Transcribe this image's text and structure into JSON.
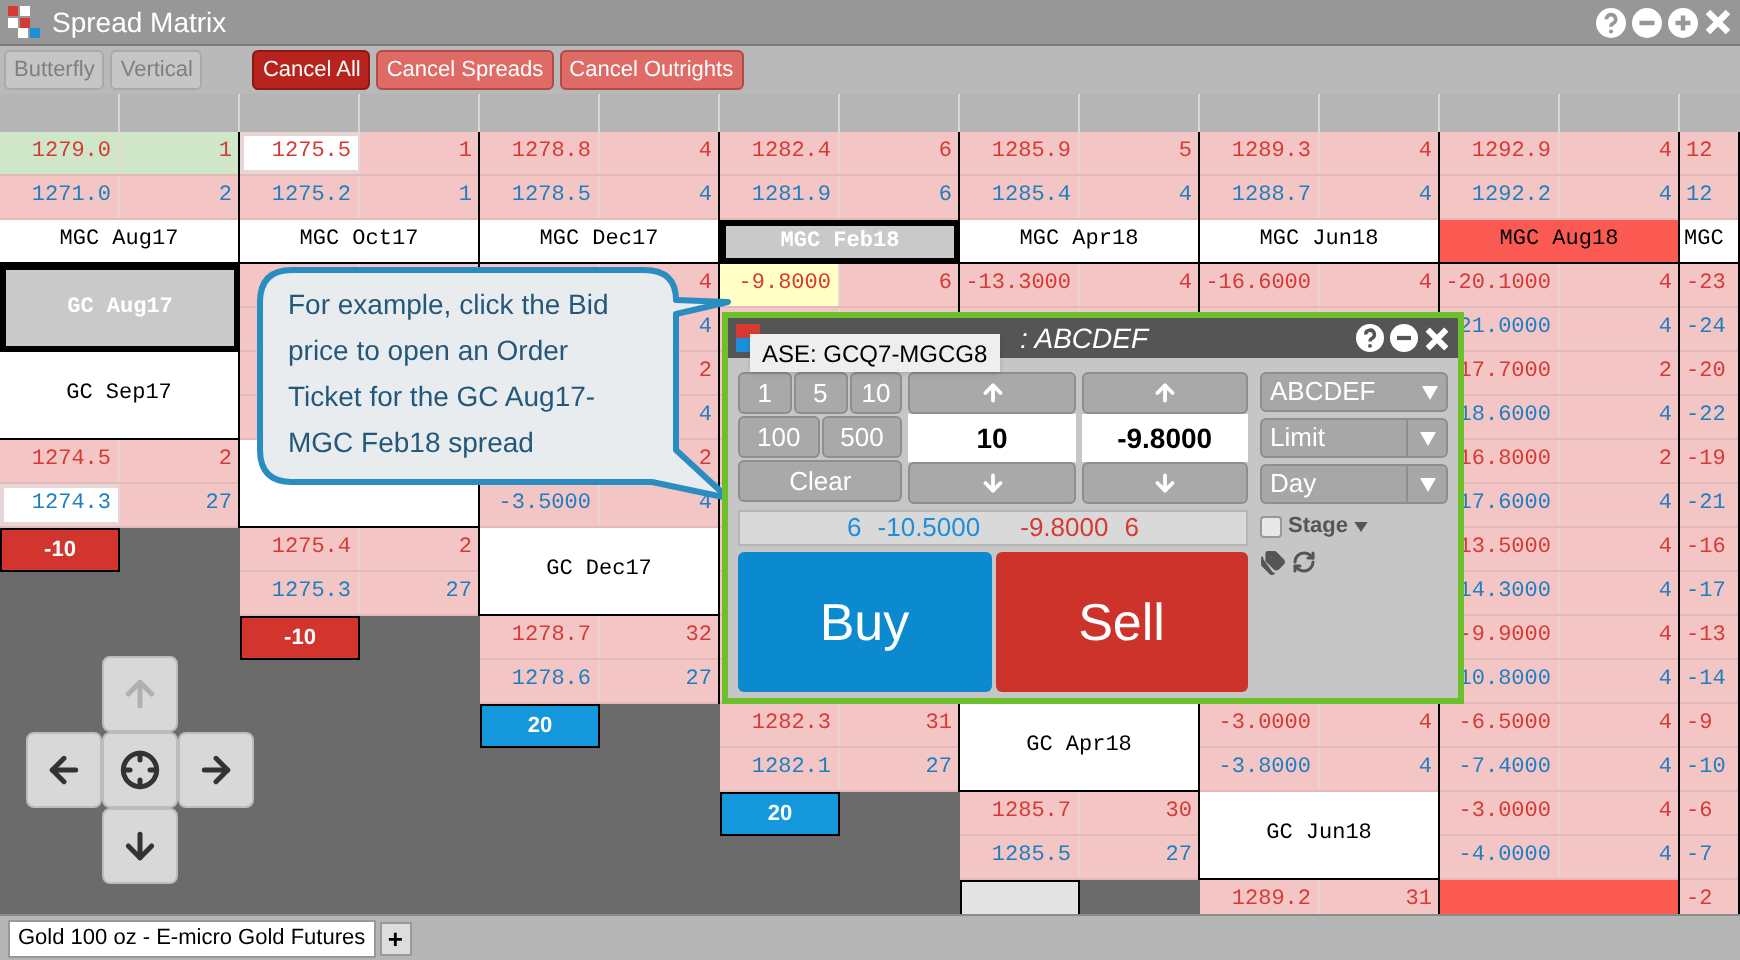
{
  "window": {
    "title": "Spread Matrix"
  },
  "toolbar": [
    {
      "label": "Butterfly",
      "kind": "toggle",
      "disabled": true
    },
    {
      "label": "Vertical",
      "kind": "toggle",
      "disabled": true
    },
    {
      "label": "Cancel All",
      "kind": "primary",
      "disabled": false
    },
    {
      "label": "Cancel Spreads",
      "kind": "secondary",
      "disabled": false
    },
    {
      "label": "Cancel Outrights",
      "kind": "secondary",
      "disabled": false
    }
  ],
  "matrix": {
    "rows": [
      {
        "kind": "quotes",
        "cells": [
          {
            "kind": "quote",
            "ask": {
              "price": "1279.0",
              "qty": "1",
              "shaded": true
            },
            "bid": {
              "price": "1271.0",
              "qty": "2"
            }
          },
          {
            "kind": "quote",
            "ask": {
              "price": "1275.5",
              "qty": "1",
              "outlined": true
            },
            "bid": {
              "price": "1275.2",
              "qty": "1"
            }
          },
          {
            "kind": "quote",
            "ask": {
              "price": "1278.8",
              "qty": "4"
            },
            "bid": {
              "price": "1278.5",
              "qty": "4"
            }
          },
          {
            "kind": "quote",
            "ask": {
              "price": "1282.4",
              "qty": "6"
            },
            "bid": {
              "price": "1281.9",
              "qty": "6"
            }
          },
          {
            "kind": "quote",
            "ask": {
              "price": "1285.9",
              "qty": "5"
            },
            "bid": {
              "price": "1285.4",
              "qty": "4"
            }
          },
          {
            "kind": "quote",
            "ask": {
              "price": "1289.3",
              "qty": "4"
            },
            "bid": {
              "price": "1288.7",
              "qty": "4"
            }
          },
          {
            "kind": "quote",
            "ask": {
              "price": "1292.9",
              "qty": "4"
            },
            "bid": {
              "price": "1292.2",
              "qty": "4"
            }
          },
          {
            "kind": "quote",
            "ask": {
              "price": "12"
            },
            "bid": {
              "price": "12"
            }
          }
        ]
      },
      {
        "kind": "labels",
        "cells": [
          {
            "kind": "label",
            "text": "MGC Aug17",
            "selected": false,
            "alert": false
          },
          {
            "kind": "label",
            "text": "MGC Oct17",
            "selected": false,
            "alert": false
          },
          {
            "kind": "label",
            "text": "MGC Dec17",
            "selected": false,
            "alert": false
          },
          {
            "kind": "label",
            "text": "MGC Feb18",
            "selected": true,
            "alert": false
          },
          {
            "kind": "label",
            "text": "MGC Apr18",
            "selected": false,
            "alert": false
          },
          {
            "kind": "label",
            "text": "MGC Jun18",
            "selected": false,
            "alert": false
          },
          {
            "kind": "label",
            "text": "MGC Aug18",
            "selected": false,
            "alert": true
          },
          {
            "kind": "label",
            "text": "MGC",
            "selected": false,
            "alert": false
          }
        ]
      },
      {
        "kind": "spreads",
        "cells": [
          {
            "kind": "label",
            "text": "GC Aug17",
            "selected": true,
            "alert": false
          },
          {
            "kind": "quote"
          },
          {
            "kind": "quote",
            "ask": {
              "qty": "4"
            },
            "bid": {
              "qty": "4"
            }
          },
          {
            "kind": "quote",
            "ask": {
              "price": "-9.8000",
              "qty": "6",
              "highlighted": true
            }
          },
          {
            "kind": "quote",
            "ask": {
              "price": "-13.3000",
              "qty": "4"
            }
          },
          {
            "kind": "quote",
            "ask": {
              "price": "-16.6000",
              "qty": "4"
            }
          },
          {
            "kind": "quote",
            "ask": {
              "price": "-20.1000",
              "qty": "4"
            },
            "bid": {
              "price": "21.0000",
              "qty": "4"
            }
          },
          {
            "kind": "quote",
            "ask": {
              "price": "-23"
            },
            "bid": {
              "price": "-24"
            }
          }
        ]
      },
      {
        "kind": "spreads",
        "cells": [
          {
            "kind": "label",
            "text": "GC Sep17",
            "selected": false,
            "alert": false
          },
          {
            "kind": "quote"
          },
          {
            "kind": "quote",
            "ask": {
              "qty": "2"
            },
            "bid": {
              "qty": "4"
            }
          },
          {
            "kind": "quote"
          },
          {
            "kind": "quote"
          },
          {
            "kind": "quote"
          },
          {
            "kind": "quote",
            "ask": {
              "price": "17.7000",
              "qty": "2"
            },
            "bid": {
              "price": "18.6000",
              "qty": "4"
            }
          },
          {
            "kind": "quote",
            "ask": {
              "price": "-20"
            },
            "bid": {
              "price": "-22"
            }
          }
        ]
      },
      {
        "kind": "spreads",
        "cells": [
          {
            "kind": "quote",
            "ask": {
              "price": "1274.5",
              "qty": "2"
            },
            "bid": {
              "price": "1274.3",
              "qty": "27",
              "outlined": true
            }
          },
          {
            "kind": "blank"
          },
          {
            "kind": "quote",
            "ask": {
              "qty": "2"
            },
            "bid": {
              "price": "-3.5000",
              "qty": "4"
            }
          },
          {
            "kind": "quote"
          },
          {
            "kind": "quote"
          },
          {
            "kind": "quote"
          },
          {
            "kind": "quote",
            "ask": {
              "price": "16.8000",
              "qty": "2"
            },
            "bid": {
              "price": "17.6000",
              "qty": "4"
            }
          },
          {
            "kind": "quote",
            "ask": {
              "price": "-19"
            },
            "bid": {
              "price": "-21"
            }
          }
        ]
      },
      {
        "kind": "spreads",
        "cells": [
          {
            "kind": "sell_order",
            "text": "-10"
          },
          {
            "kind": "quote",
            "ask": {
              "price": "1275.4",
              "qty": "2"
            },
            "bid": {
              "price": "1275.3",
              "qty": "27"
            }
          },
          {
            "kind": "label",
            "text": "GC Dec17",
            "selected": false,
            "alert": false
          },
          {
            "kind": "quote"
          },
          {
            "kind": "quote"
          },
          {
            "kind": "quote"
          },
          {
            "kind": "quote",
            "ask": {
              "price": "13.5000",
              "qty": "4"
            },
            "bid": {
              "price": "14.3000",
              "qty": "4"
            }
          },
          {
            "kind": "quote",
            "ask": {
              "price": "-16"
            },
            "bid": {
              "price": "-17"
            }
          }
        ]
      },
      {
        "kind": "spreads",
        "cells": [
          {
            "kind": "dark"
          },
          {
            "kind": "sell_order",
            "text": "-10"
          },
          {
            "kind": "quote",
            "ask": {
              "price": "1278.7",
              "qty": "32"
            },
            "bid": {
              "price": "1278.6",
              "qty": "27"
            }
          },
          {
            "kind": "quote"
          },
          {
            "kind": "quote"
          },
          {
            "kind": "quote"
          },
          {
            "kind": "quote",
            "ask": {
              "price": "-9.9000",
              "qty": "4"
            },
            "bid": {
              "price": "10.8000",
              "qty": "4"
            }
          },
          {
            "kind": "quote",
            "ask": {
              "price": "-13"
            },
            "bid": {
              "price": "-14"
            }
          }
        ]
      },
      {
        "kind": "spreads",
        "cells": [
          {
            "kind": "dark"
          },
          {
            "kind": "dark"
          },
          {
            "kind": "buy_order",
            "text": "20"
          },
          {
            "kind": "quote",
            "ask": {
              "price": "1282.3",
              "qty": "31"
            },
            "bid": {
              "price": "1282.1",
              "qty": "27"
            }
          },
          {
            "kind": "label",
            "text": "GC Apr18",
            "selected": false,
            "alert": false
          },
          {
            "kind": "quote",
            "ask": {
              "price": "-3.0000",
              "qty": "4"
            },
            "bid": {
              "price": "-3.8000",
              "qty": "4"
            }
          },
          {
            "kind": "quote",
            "ask": {
              "price": "-6.5000",
              "qty": "4"
            },
            "bid": {
              "price": "-7.4000",
              "qty": "4"
            }
          },
          {
            "kind": "quote",
            "ask": {
              "price": "-9"
            },
            "bid": {
              "price": "-10"
            }
          }
        ]
      },
      {
        "kind": "spreads",
        "cells": [
          {
            "kind": "dark"
          },
          {
            "kind": "dark"
          },
          {
            "kind": "dark"
          },
          {
            "kind": "buy_order",
            "text": "20"
          },
          {
            "kind": "quote",
            "ask": {
              "price": "1285.7",
              "qty": "30"
            },
            "bid": {
              "price": "1285.5",
              "qty": "27"
            }
          },
          {
            "kind": "label",
            "text": "GC Jun18",
            "selected": false,
            "alert": false
          },
          {
            "kind": "quote",
            "ask": {
              "price": "-3.0000",
              "qty": "4"
            },
            "bid": {
              "price": "-4.0000",
              "qty": "4"
            }
          },
          {
            "kind": "quote",
            "ask": {
              "price": "-6"
            },
            "bid": {
              "price": "-7"
            }
          }
        ]
      },
      {
        "kind": "spreads",
        "cells": [
          {
            "kind": "dark"
          },
          {
            "kind": "dark"
          },
          {
            "kind": "dark"
          },
          {
            "kind": "dark"
          },
          {
            "kind": "empty_order"
          },
          {
            "kind": "quote",
            "ask": {
              "price": "1289.2",
              "qty": "31"
            }
          },
          {
            "kind": "alert_blank"
          },
          {
            "kind": "quote",
            "ask": {
              "price": "-2"
            }
          }
        ]
      }
    ]
  },
  "callout": {
    "text": "For example, click the Bid price to open an Order Ticket for the GC Aug17-MGC Feb18 spread"
  },
  "order_ticket": {
    "title": ": ABCDEF",
    "tooltip": "ASE: GCQ7-MGCG8",
    "quantity_presets": [
      "1",
      "5",
      "10",
      "100",
      "500"
    ],
    "clear": "Clear",
    "quantity": "10",
    "price": "-9.8000",
    "account": "ABCDEF",
    "order_type": "Limit",
    "duration": "Day",
    "stage": {
      "label": "Stage",
      "checked": false
    },
    "market": {
      "bid_qty": "6",
      "bid": "-10.5000",
      "ask": "-9.8000",
      "ask_qty": "6"
    },
    "buy": "Buy",
    "sell": "Sell"
  },
  "nav_pad": [
    {
      "kind": "up",
      "disabled": true
    },
    {
      "kind": "left",
      "disabled": false
    },
    {
      "kind": "center",
      "disabled": false
    },
    {
      "kind": "right",
      "disabled": false
    },
    {
      "kind": "down",
      "disabled": false
    }
  ],
  "tabs": [
    {
      "label": "Gold 100 oz - E-micro Gold Futures",
      "selected": true
    }
  ],
  "add_tab": "+"
}
